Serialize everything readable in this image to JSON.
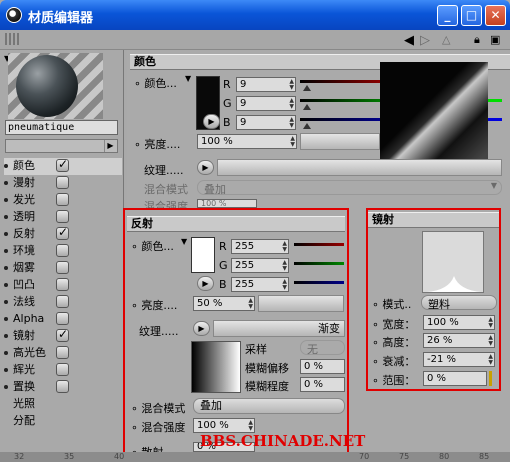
{
  "window": {
    "title": "材质编辑器",
    "minimize": "_",
    "maximize": "□",
    "close": "✕"
  },
  "material": {
    "name": "pneumatique"
  },
  "channels": [
    {
      "label": "颜色",
      "checked": true,
      "selected": true
    },
    {
      "label": "漫射",
      "checked": false
    },
    {
      "label": "发光",
      "checked": false
    },
    {
      "label": "透明",
      "checked": false
    },
    {
      "label": "反射",
      "checked": true
    },
    {
      "label": "环境",
      "checked": false
    },
    {
      "label": "烟雾",
      "checked": false
    },
    {
      "label": "凹凸",
      "checked": false
    },
    {
      "label": "法线",
      "checked": false
    },
    {
      "label": "Alpha",
      "checked": false
    },
    {
      "label": "镜射",
      "checked": true
    },
    {
      "label": "高光色",
      "checked": false
    },
    {
      "label": "辉光",
      "checked": false
    },
    {
      "label": "置换",
      "checked": false
    },
    {
      "label": "光照",
      "checked": null
    },
    {
      "label": "分配",
      "checked": null
    }
  ],
  "color_section": {
    "header": "颜色",
    "color_label": "颜色",
    "r": "9",
    "g": "9",
    "b": "9",
    "r_label": "R",
    "g_label": "G",
    "b_label": "B",
    "brightness_label": "亮度",
    "brightness": "100 %",
    "texture_label": "纹理",
    "blend_mode_label": "混合模式",
    "blend_mode": "叠加",
    "blend_strength_label": "混合强度",
    "blend_strength": "100 %",
    "swatch": "#090909"
  },
  "reflection_section": {
    "header": "反射",
    "color_label": "颜色",
    "r": "255",
    "g": "255",
    "b": "255",
    "r_label": "R",
    "g_label": "G",
    "b_label": "B",
    "brightness_label": "亮度",
    "brightness": "50 %",
    "texture_label": "纹理",
    "gradient_label": "渐变",
    "sample_label": "采样",
    "sample_value": "无",
    "blur_offset_label": "模糊偏移",
    "blur_offset": "0 %",
    "blur_degree_label": "模糊程度",
    "blur_degree": "0 %",
    "blend_mode_label": "混合模式",
    "blend_mode": "叠加",
    "blend_strength_label": "混合强度",
    "blend_strength": "100 %",
    "scatter_label": "散射",
    "scatter": "0 %",
    "swatch": "#ffffff"
  },
  "specular_section": {
    "header": "镜射",
    "mode_label": "模式",
    "mode": "塑料",
    "width_label": "宽度",
    "width": "100 %",
    "height_label": "高度",
    "height": "26 %",
    "falloff_label": "衰减",
    "falloff": "-21 %",
    "range_label": "范围",
    "range": "0 %"
  },
  "ruler_ticks": [
    "32",
    "35",
    "40",
    "70",
    "75",
    "80",
    "85"
  ],
  "watermark": "BBS.CHINADE.NET",
  "colors": {
    "highlight_box": "#e00000",
    "titlebar": "#0a55d8"
  }
}
